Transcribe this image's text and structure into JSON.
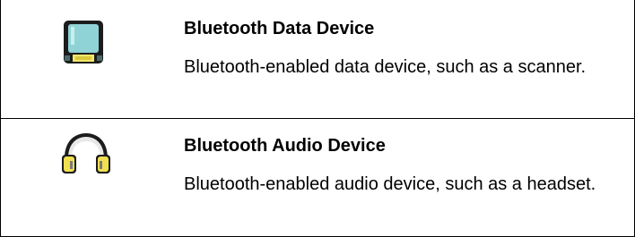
{
  "rows": [
    {
      "icon": "bluetooth-data-device-icon",
      "title": "Bluetooth Data Device",
      "description": "Bluetooth-enabled data device, such as a scanner."
    },
    {
      "icon": "bluetooth-audio-device-icon",
      "title": "Bluetooth Audio Device",
      "description": "Bluetooth-enabled audio device, such as a headset."
    }
  ],
  "colors": {
    "data_screen": "#8fd3d6",
    "data_body": "#1c1c1c",
    "data_base": "#f3e76a",
    "audio_ear": "#f0e050",
    "audio_band": "#1c1c1c"
  }
}
